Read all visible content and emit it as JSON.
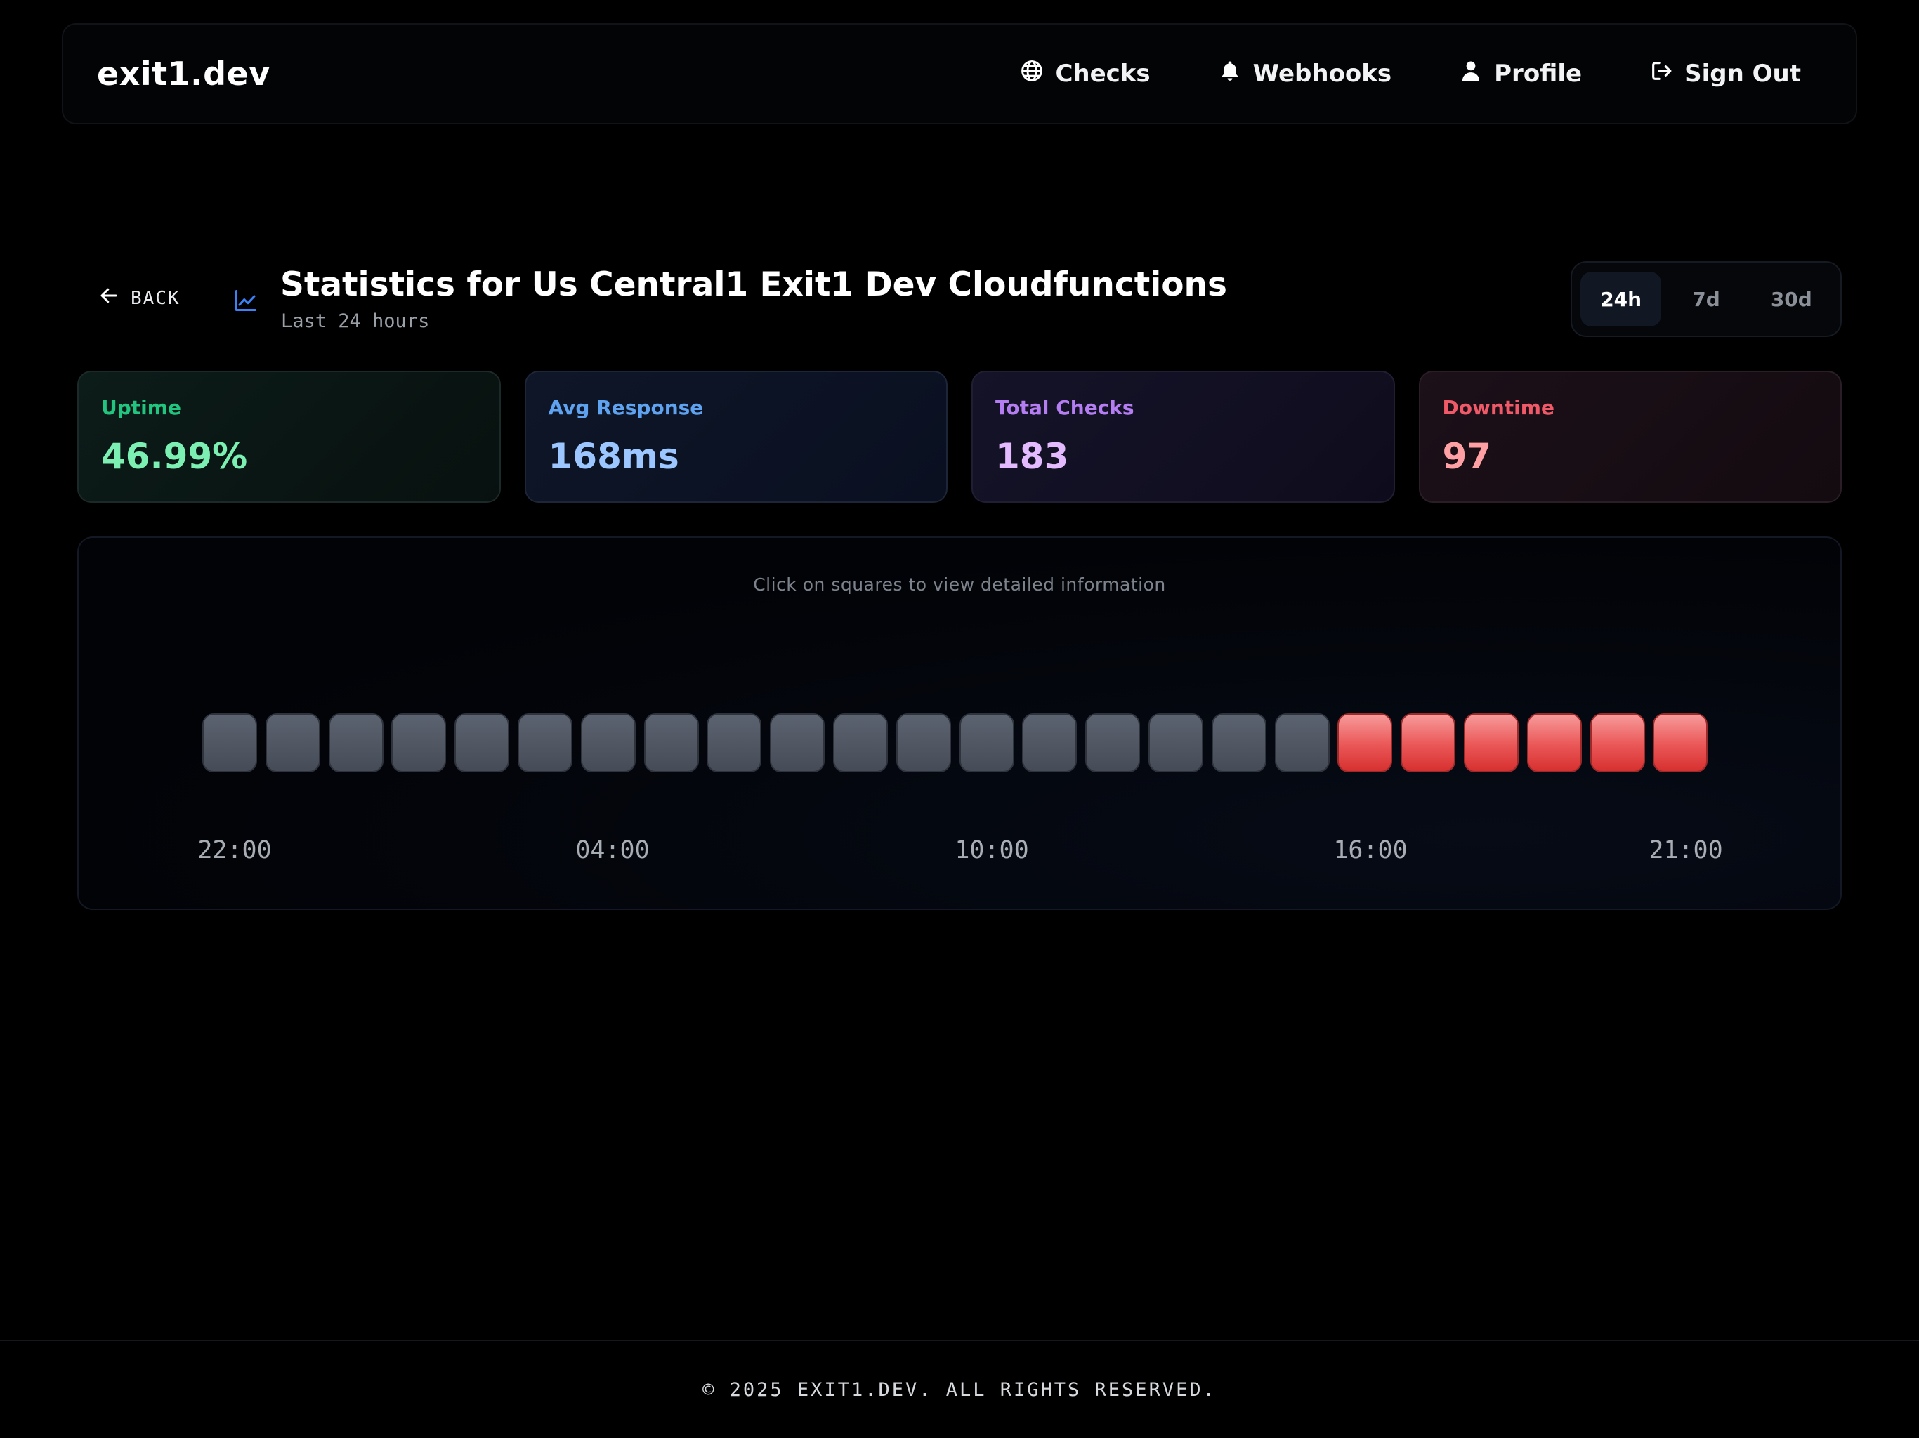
{
  "nav": {
    "brand": "exit1.dev",
    "links": [
      {
        "label": "Checks",
        "icon": "globe-icon"
      },
      {
        "label": "Webhooks",
        "icon": "bell-icon"
      },
      {
        "label": "Profile",
        "icon": "user-icon"
      },
      {
        "label": "Sign Out",
        "icon": "sign-out-icon"
      }
    ]
  },
  "header": {
    "back_label": "BACK",
    "title": "Statistics for Us Central1 Exit1 Dev Cloudfunctions",
    "subtitle": "Last 24 hours",
    "ranges": [
      "24h",
      "7d",
      "30d"
    ],
    "active_range": "24h"
  },
  "stats": {
    "uptime": {
      "label": "Uptime",
      "value": "46.99%"
    },
    "avg_response": {
      "label": "Avg Response",
      "value": "168ms"
    },
    "total_checks": {
      "label": "Total Checks",
      "value": "183"
    },
    "downtime": {
      "label": "Downtime",
      "value": "97"
    }
  },
  "timeline": {
    "hint": "Click on squares to view detailed information",
    "squares": [
      "unknown",
      "unknown",
      "unknown",
      "unknown",
      "unknown",
      "unknown",
      "unknown",
      "unknown",
      "unknown",
      "unknown",
      "unknown",
      "unknown",
      "unknown",
      "unknown",
      "unknown",
      "unknown",
      "unknown",
      "unknown",
      "down",
      "down",
      "down",
      "down",
      "down",
      "down"
    ],
    "ticks": [
      "22:00",
      "04:00",
      "10:00",
      "16:00",
      "21:00"
    ],
    "colors": {
      "unknown": "#515865",
      "down": "#e84a4a"
    }
  },
  "footer": {
    "text": "© 2025 EXIT1.DEV. ALL RIGHTS RESERVED."
  }
}
